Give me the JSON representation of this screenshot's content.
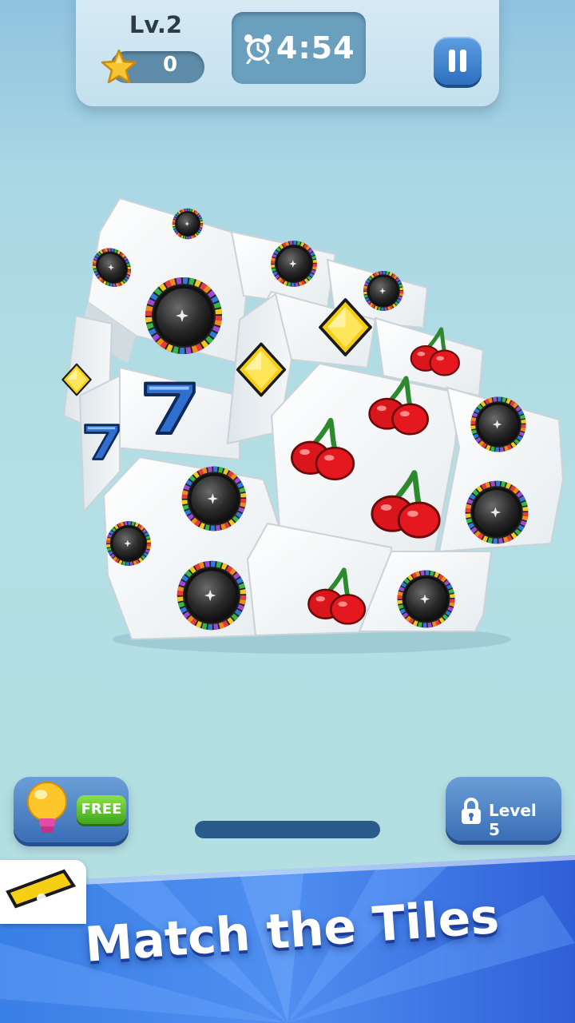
{
  "hud": {
    "level": "Lv.2",
    "stars": "0",
    "timer": "4:54"
  },
  "icons": {
    "star": "star-icon",
    "clock": "alarm-clock-icon",
    "pause": "pause-icon",
    "hint": "light-bulb-icon",
    "lock": "lock-icon"
  },
  "board": {
    "tile_faces": [
      "roulette-wheel",
      "yellow-diamond",
      "red-cherries",
      "blue-seven"
    ]
  },
  "controls": {
    "hint_badge": "FREE",
    "locked_label": "Level 5"
  },
  "banner": {
    "headline": "Match the Tiles"
  },
  "colors": {
    "accent_blue": "#3a6eb6",
    "free_green": "#3fa61e",
    "banner_blue": "#2a56d6"
  }
}
